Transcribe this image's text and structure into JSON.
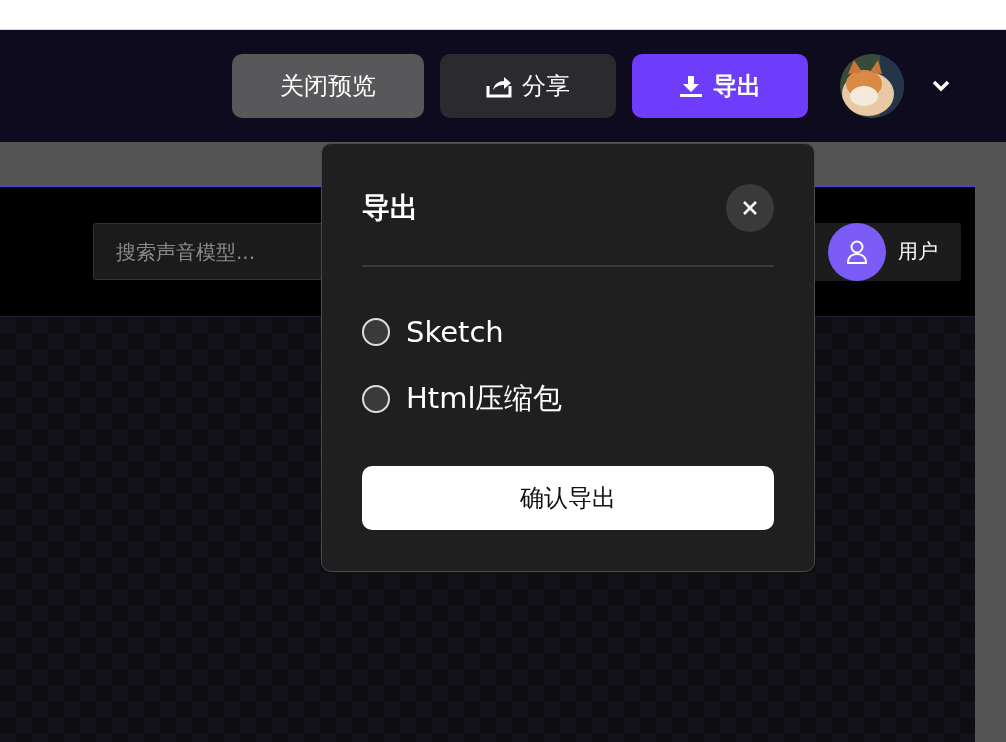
{
  "header": {
    "buttons": [
      {
        "kind": "plain",
        "label": "关闭预览"
      },
      {
        "kind": "share",
        "label": "分享"
      },
      {
        "kind": "export",
        "label": "导出"
      }
    ]
  },
  "preview": {
    "search": {
      "placeholder": "搜索声音模型..."
    },
    "user_button": "用户"
  },
  "export_dialog": {
    "title": "导出",
    "options": [
      {
        "label": "Sketch",
        "selected": false
      },
      {
        "label": "Html压缩包",
        "selected": false
      }
    ],
    "confirm": "确认导出"
  }
}
